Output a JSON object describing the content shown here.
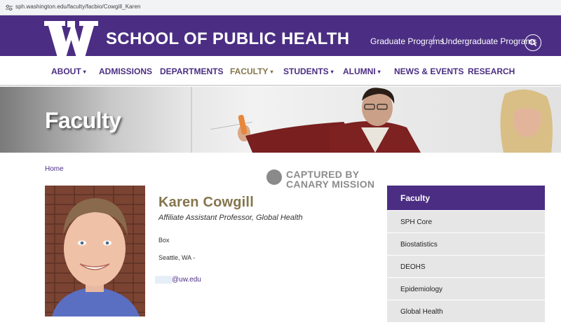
{
  "browser": {
    "url": "sph.washington.edu/faculty/facbio/Cowgill_Karen"
  },
  "header": {
    "logo_letter": "W",
    "school_name": "SCHOOL OF PUBLIC HEALTH",
    "links": [
      "Graduate Programs",
      "Undergraduate Programs"
    ],
    "search_icon": "search-icon"
  },
  "nav": {
    "items": [
      {
        "label": "ABOUT",
        "dropdown": true
      },
      {
        "label": "ADMISSIONS",
        "dropdown": false
      },
      {
        "label": "DEPARTMENTS",
        "dropdown": false
      },
      {
        "label": "FACULTY",
        "dropdown": true
      },
      {
        "label": "STUDENTS",
        "dropdown": true
      },
      {
        "label": "ALUMNI",
        "dropdown": true
      },
      {
        "label": "NEWS & EVENTS",
        "dropdown": false
      },
      {
        "label": "RESEARCH",
        "dropdown": false
      }
    ],
    "caret": "▾"
  },
  "hero": {
    "title": "Faculty"
  },
  "breadcrumb": {
    "home": "Home"
  },
  "watermark": {
    "line1": "CAPTURED BY",
    "line2": "CANARY MISSION"
  },
  "profile": {
    "name": "Karen Cowgill",
    "title": "Affiliate Assistant Professor, Global Health",
    "box": "Box",
    "city": "Seattle, WA -",
    "email_domain": "@uw.edu"
  },
  "sidebar": {
    "heading": "Faculty",
    "items": [
      "SPH Core",
      "Biostatistics",
      "DEOHS",
      "Epidemiology",
      "Global Health"
    ]
  },
  "colors": {
    "uw_purple": "#4b2e83",
    "uw_gold": "#85754d",
    "sidebar_gray": "#e6e6e6"
  }
}
